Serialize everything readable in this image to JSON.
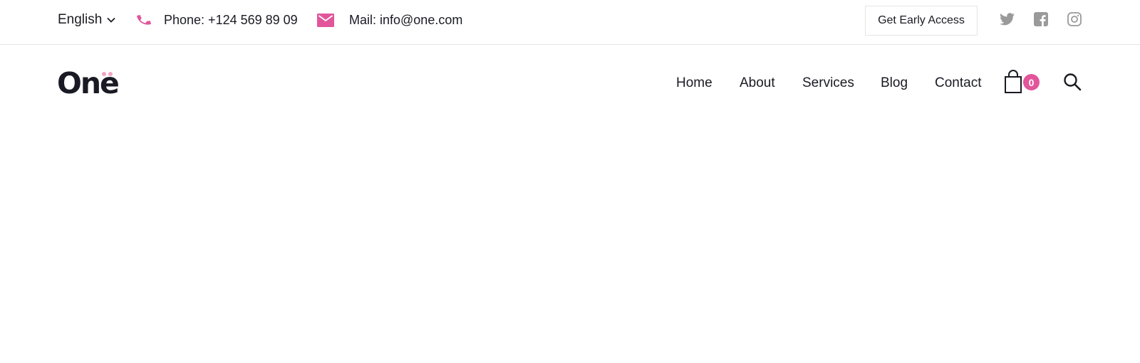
{
  "topbar": {
    "language": "English",
    "phone": "Phone: +124 569 89 09",
    "mail": "Mail: info@one.com",
    "cta_label": "Get Early Access",
    "social": [
      "twitter-icon",
      "facebook-icon",
      "instagram-icon"
    ]
  },
  "header": {
    "logo": "One",
    "nav": [
      "Home",
      "About",
      "Services",
      "Blog",
      "Contact"
    ],
    "cart_count": "0"
  },
  "colors": {
    "accent": "#e2559b",
    "text": "#1a1a24",
    "social_icon": "#9a9a9a",
    "divider": "#e6e6e6"
  }
}
